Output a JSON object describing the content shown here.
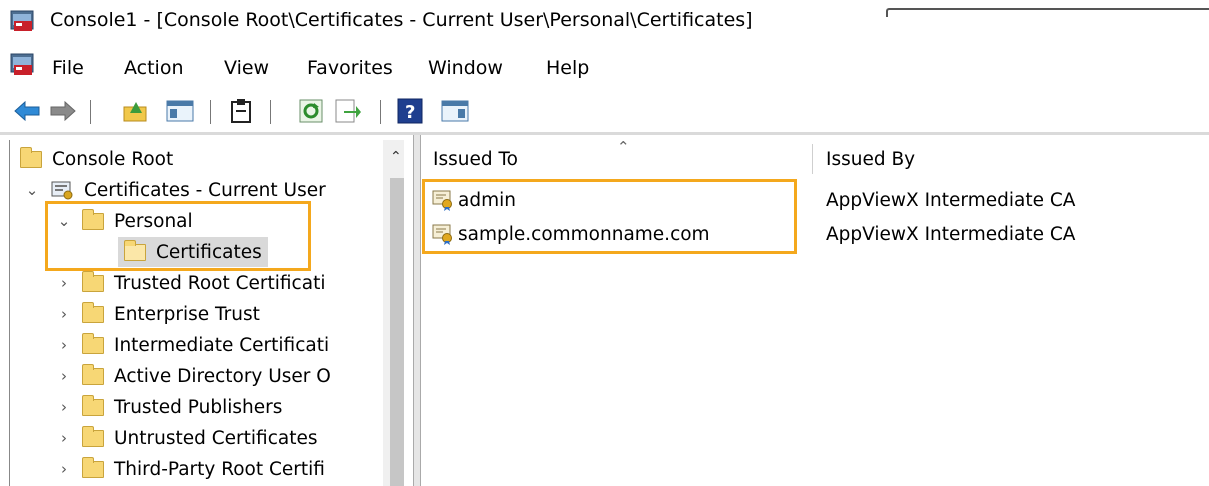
{
  "window": {
    "title": "Console1 - [Console Root\\Certificates - Current User\\Personal\\Certificates]"
  },
  "menu": {
    "items": [
      "File",
      "Action",
      "View",
      "Favorites",
      "Window",
      "Help"
    ]
  },
  "tree": {
    "items": [
      {
        "label": "Console Root",
        "chevron": "",
        "icon": "folder-icon"
      },
      {
        "label": "Certificates - Current User",
        "chevron": "v",
        "icon": "certificate-store-icon"
      },
      {
        "label": "Personal",
        "chevron": "v",
        "icon": "folder-icon"
      },
      {
        "label": "Certificates",
        "chevron": "",
        "icon": "folder-open-icon",
        "selected": true
      },
      {
        "label": "Trusted Root Certificati",
        "chevron": ">",
        "icon": "folder-icon"
      },
      {
        "label": "Enterprise Trust",
        "chevron": ">",
        "icon": "folder-icon"
      },
      {
        "label": "Intermediate Certificati",
        "chevron": ">",
        "icon": "folder-icon"
      },
      {
        "label": "Active Directory User O",
        "chevron": ">",
        "icon": "folder-icon"
      },
      {
        "label": "Trusted Publishers",
        "chevron": ">",
        "icon": "folder-icon"
      },
      {
        "label": "Untrusted Certificates",
        "chevron": ">",
        "icon": "folder-icon"
      },
      {
        "label": "Third-Party Root Certifi",
        "chevron": ">",
        "icon": "folder-icon"
      }
    ]
  },
  "list": {
    "columns": [
      "Issued To",
      "Issued By"
    ],
    "rows": [
      {
        "issued_to": "admin",
        "issued_by": "AppViewX Intermediate CA"
      },
      {
        "issued_to": "sample.commonname.com",
        "issued_by": "AppViewX Intermediate CA"
      }
    ]
  },
  "colors": {
    "highlight": "#f4a81d",
    "folder": "#f7d775",
    "selection": "#d9d9d9"
  }
}
